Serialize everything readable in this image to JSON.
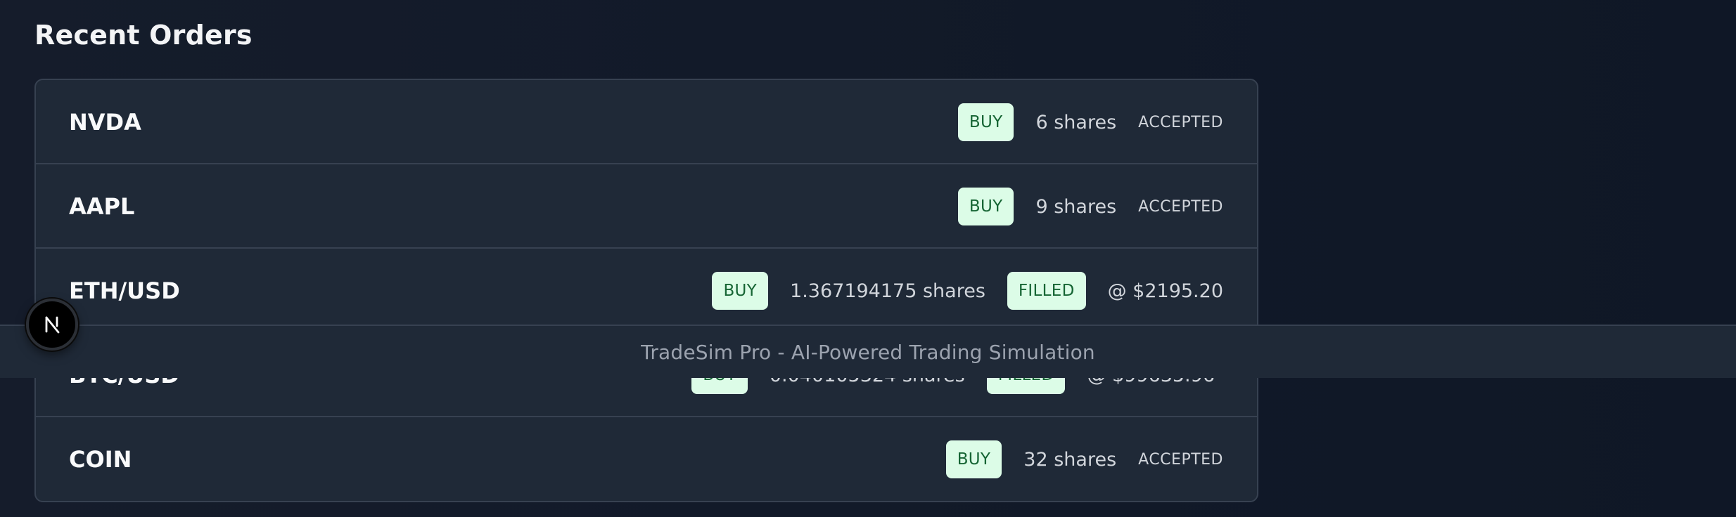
{
  "page": {
    "title": "Recent Orders"
  },
  "orders": [
    {
      "symbol": "NVDA",
      "side": "BUY",
      "quantity": "6 shares",
      "status": "ACCEPTED",
      "price": ""
    },
    {
      "symbol": "AAPL",
      "side": "BUY",
      "quantity": "9 shares",
      "status": "ACCEPTED",
      "price": ""
    },
    {
      "symbol": "ETH/USD",
      "side": "BUY",
      "quantity": "1.367194175 shares",
      "status": "FILLED",
      "price": "@ $2195.20"
    },
    {
      "symbol": "BTC/USD",
      "side": "BUY",
      "quantity": "0.040105324 shares",
      "status": "FILLED",
      "price": "@ $99635.96"
    },
    {
      "symbol": "COIN",
      "side": "BUY",
      "quantity": "32 shares",
      "status": "ACCEPTED",
      "price": ""
    }
  ],
  "footer": {
    "text": "TradeSim Pro - AI-Powered Trading Simulation"
  },
  "dev_indicator": {
    "icon": "nextjs-logo-icon",
    "letter": "N"
  },
  "colors": {
    "background": "#111827",
    "card": "#1f2937",
    "border": "#374151",
    "buy_badge_bg": "#dcfce7",
    "buy_badge_text": "#166534",
    "status_filled_bg": "#dcfce7"
  }
}
